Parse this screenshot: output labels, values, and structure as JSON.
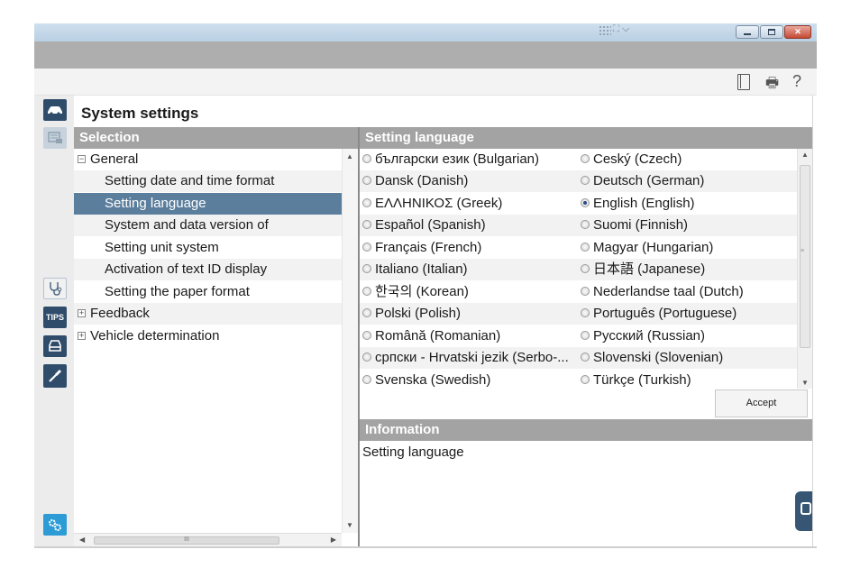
{
  "window": {
    "controls": {
      "minimize": "",
      "maximize": "",
      "close": "✕"
    },
    "toolbar_icons": [
      "book-icon",
      "printer-icon",
      "help-icon"
    ],
    "help_glyph": "?"
  },
  "sidebar_icons": [
    "car-icon",
    "vehicle-list-icon",
    "stethoscope-icon",
    "tips-icon",
    "vehicle-front-icon",
    "screwdriver-icon",
    "settings-gears-icon"
  ],
  "sidebar": {
    "tips_label": "TIPS"
  },
  "heading": "System settings",
  "selection": {
    "header": "Selection",
    "items": [
      {
        "label": "General",
        "level": 0,
        "expanded": true
      },
      {
        "label": "Setting date and time format",
        "level": 1
      },
      {
        "label": "Setting language",
        "level": 1,
        "selected": true
      },
      {
        "label": "System and data version of",
        "level": 1
      },
      {
        "label": "Setting unit system",
        "level": 1
      },
      {
        "label": "Activation of text ID display",
        "level": 1
      },
      {
        "label": "Setting the paper format",
        "level": 1
      },
      {
        "label": "Feedback",
        "level": 0,
        "expanded": false
      },
      {
        "label": "Vehicle determination",
        "level": 0,
        "expanded": false
      }
    ],
    "hscroll_grip": "III"
  },
  "language": {
    "header": "Setting language",
    "selected": "English (English)",
    "options": [
      [
        "български език (Bulgarian)",
        "Ceský (Czech)"
      ],
      [
        "Dansk (Danish)",
        "Deutsch (German)"
      ],
      [
        "ΕΛΛΗΝΙΚΟΣ (Greek)",
        "English (English)"
      ],
      [
        "Español (Spanish)",
        "Suomi (Finnish)"
      ],
      [
        "Français (French)",
        "Magyar (Hungarian)"
      ],
      [
        "Italiano (Italian)",
        "日本語 (Japanese)"
      ],
      [
        "한국의 (Korean)",
        "Nederlandse taal (Dutch)"
      ],
      [
        "Polski (Polish)",
        "Português (Portuguese)"
      ],
      [
        "Română (Romanian)",
        "Русский (Russian)"
      ],
      [
        "српски - Hrvatski jezik (Serbo-...",
        "Slovenski (Slovenian)"
      ],
      [
        "Svenska (Swedish)",
        "Türkçe (Turkish)"
      ]
    ],
    "accept_label": "Accept"
  },
  "information": {
    "header": "Information",
    "text": "Setting language"
  }
}
